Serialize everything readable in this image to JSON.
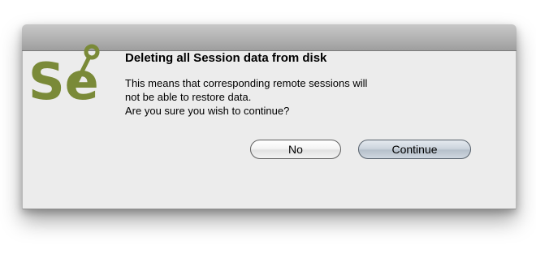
{
  "dialog": {
    "title": "Deleting all Session data from disk",
    "message_lines": [
      "This means that corresponding remote sessions will",
      "not be able to restore data.",
      "Are you sure you wish to continue?"
    ],
    "buttons": {
      "no_label": "No",
      "continue_label": "Continue"
    },
    "logo": {
      "icon": "selenium-logo",
      "text": "Se",
      "color": "#7a8a38"
    }
  },
  "colors": {
    "window_background": "#ececec",
    "titlebar_top": "#c8c8c8",
    "titlebar_bottom": "#9e9e9e",
    "default_button": "#c4ccd6"
  }
}
